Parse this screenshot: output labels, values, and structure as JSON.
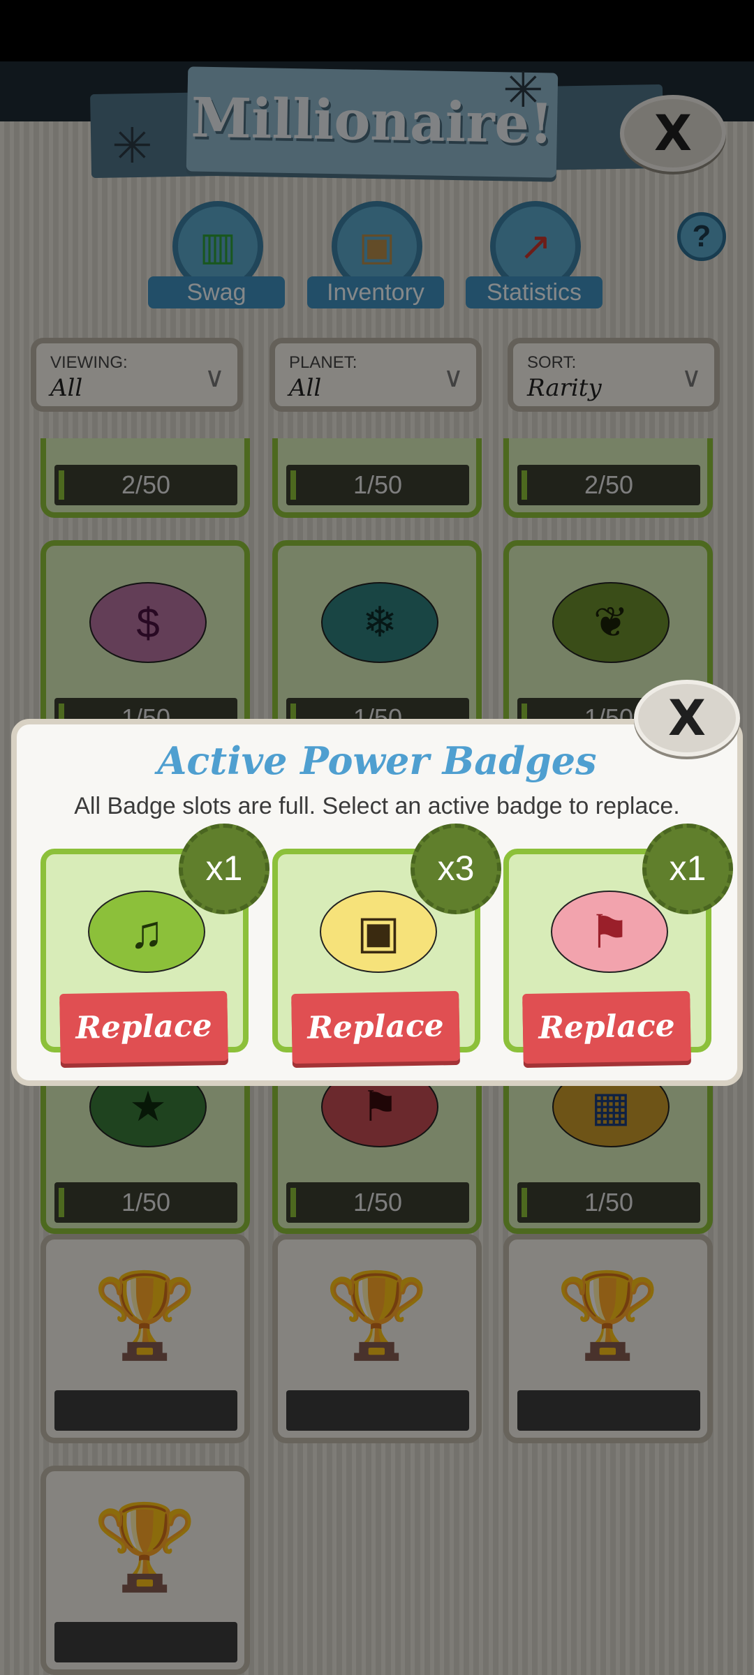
{
  "header": {
    "title": "Millionaire!",
    "close_label": "X",
    "help_label": "?"
  },
  "nav": [
    {
      "label": "Swag",
      "icon": "swag-icon"
    },
    {
      "label": "Inventory",
      "icon": "inventory-icon"
    },
    {
      "label": "Statistics",
      "icon": "statistics-icon"
    }
  ],
  "filters": [
    {
      "caption": "VIEWING:",
      "value": "All"
    },
    {
      "caption": "PLANET:",
      "value": "All"
    },
    {
      "caption": "SORT:",
      "value": "Rarity"
    }
  ],
  "grid": {
    "row1": [
      "2/50",
      "1/50",
      "2/50"
    ],
    "row2": [
      {
        "progress": "1/50",
        "icon": "pixel-dollar-icon",
        "color": "#b4729f"
      },
      {
        "progress": "1/50",
        "icon": "snowflake-icon",
        "color": "#2f7f7c"
      },
      {
        "progress": "1/50",
        "icon": "holly-icon",
        "color": "#6b8c2c"
      }
    ],
    "row3": [
      "1/50",
      "1/50",
      "1/50"
    ]
  },
  "modal": {
    "title": "Active Power Badges",
    "subtitle": "All Badge slots are full. Select an active badge to replace.",
    "close_label": "X",
    "slots": [
      {
        "count": "x1",
        "icon": "music-note-icon",
        "color": "#8cc03a",
        "button": "Replace"
      },
      {
        "count": "x3",
        "icon": "television-icon",
        "color": "#f6e27a",
        "button": "Replace"
      },
      {
        "count": "x1",
        "icon": "red-flag-icon",
        "color": "#f2a3ad",
        "button": "Replace"
      }
    ]
  },
  "colors": {
    "accent_green": "#8cc03a",
    "title_blue": "#4f9fd0",
    "replace_red": "#e04f52"
  }
}
